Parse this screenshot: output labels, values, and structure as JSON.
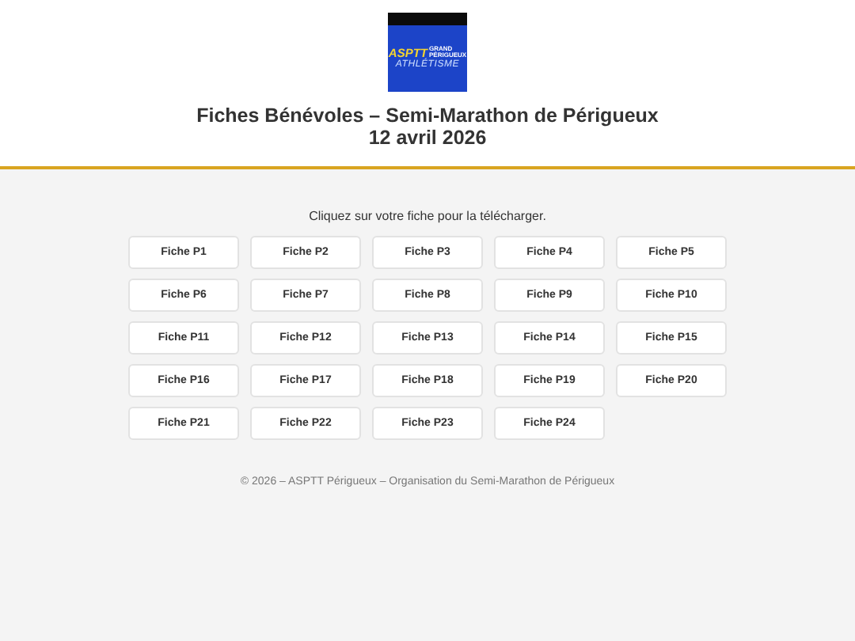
{
  "logo": {
    "brand": "ASPTT",
    "lines": [
      "GRAND",
      "PÉRIGUEUX"
    ],
    "tagline": "ATHLÉTISME"
  },
  "title": "Fiches Bénévoles – Semi-Marathon de Périgueux",
  "date": "12 avril 2026",
  "instruction": "Cliquez sur votre fiche pour la télécharger.",
  "fiches": [
    "Fiche P1",
    "Fiche P2",
    "Fiche P3",
    "Fiche P4",
    "Fiche P5",
    "Fiche P6",
    "Fiche P7",
    "Fiche P8",
    "Fiche P9",
    "Fiche P10",
    "Fiche P11",
    "Fiche P12",
    "Fiche P13",
    "Fiche P14",
    "Fiche P15",
    "Fiche P16",
    "Fiche P17",
    "Fiche P18",
    "Fiche P19",
    "Fiche P20",
    "Fiche P21",
    "Fiche P22",
    "Fiche P23",
    "Fiche P24"
  ],
  "footer": "© 2026 – ASPTT Périgueux – Organisation du Semi-Marathon de Périgueux"
}
